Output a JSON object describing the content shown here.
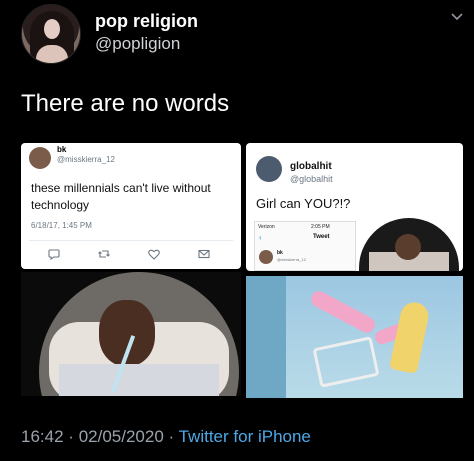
{
  "author": {
    "name": "pop religion",
    "handle": "@popligion"
  },
  "tweet": {
    "text": "There are no words"
  },
  "embedded": {
    "left_screenshot": {
      "user_tag": "bk",
      "handle": "@misskierra_12",
      "body": "these millennials can't live without technology",
      "date": "6/18/17, 1:45 PM"
    },
    "right_screenshot": {
      "name": "globalhit",
      "handle": "@globalhit",
      "text": "Girl can YOU?!?",
      "inner": {
        "carrier": "Verizon",
        "time": "2:05 PM",
        "nav_title": "Tweet",
        "user_tag": "bk",
        "handle": "@misskierra_12"
      }
    }
  },
  "meta": {
    "time": "16:42",
    "date": "02/05/2020",
    "separator": "·",
    "source": "Twitter for iPhone"
  }
}
